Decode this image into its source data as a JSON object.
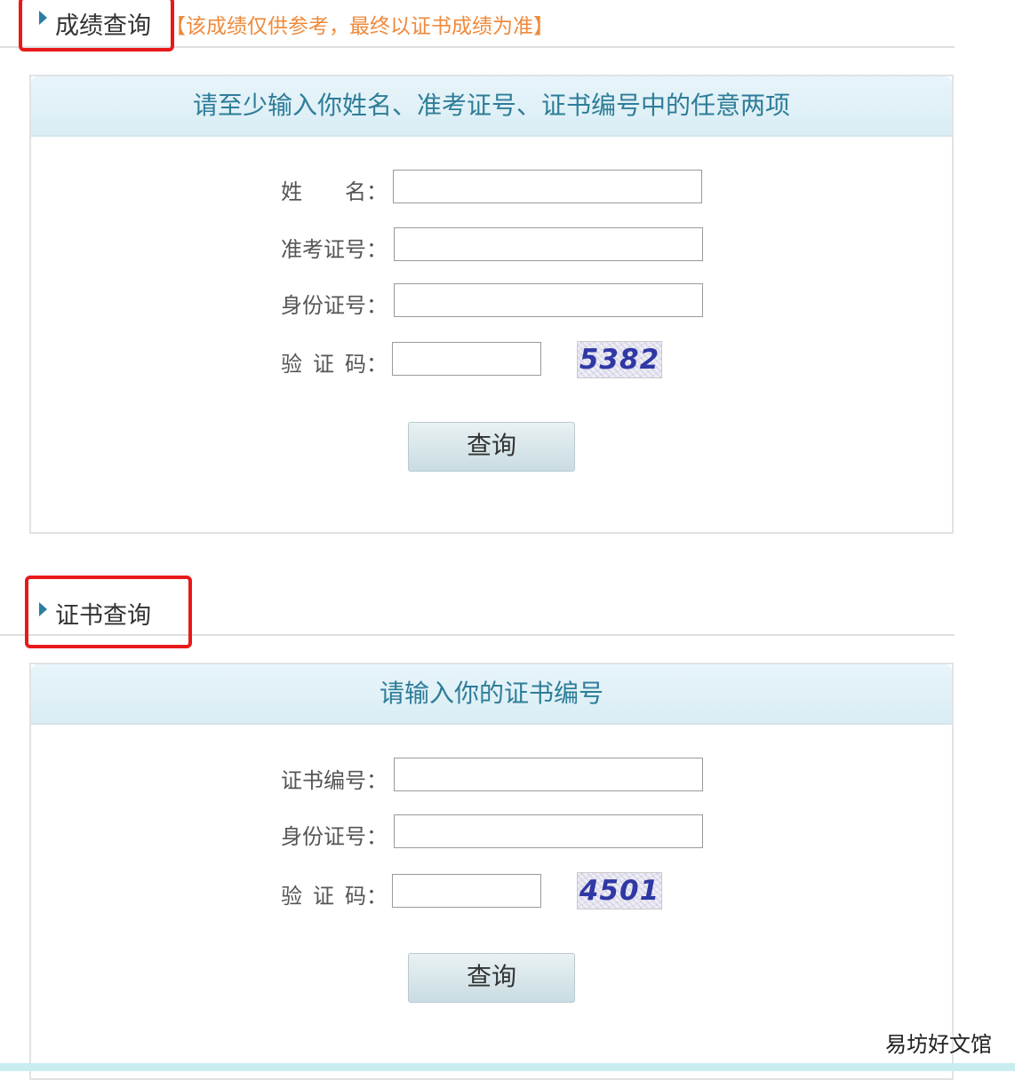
{
  "score_section": {
    "title": "成绩查询",
    "note": "【该成绩仅供参考，最终以证书成绩为准】",
    "panel_header": "请至少输入你姓名、准考证号、证书编号中的任意两项",
    "labels": {
      "name": "姓　　名：",
      "exam_no": "准考证号：",
      "id_no": "身份证号：",
      "captcha": "验 证 码："
    },
    "fields": {
      "name": "",
      "exam_no": "",
      "id_no": "",
      "captcha": ""
    },
    "captcha_text": "5382",
    "button_label": "查询"
  },
  "cert_section": {
    "title": "证书查询",
    "panel_header": "请输入你的证书编号",
    "labels": {
      "cert_no": "证书编号：",
      "id_no": "身份证号：",
      "captcha": "验 证 码："
    },
    "fields": {
      "cert_no": "",
      "id_no": "",
      "captcha": ""
    },
    "captcha_text": "4501",
    "button_label": "查询"
  },
  "watermark": "易坊好文馆",
  "colors": {
    "accent_text": "#2e7d98",
    "note_orange": "#ef8a3c",
    "highlight_red": "#e8191a",
    "triangle_blue": "#2c7ea2"
  }
}
